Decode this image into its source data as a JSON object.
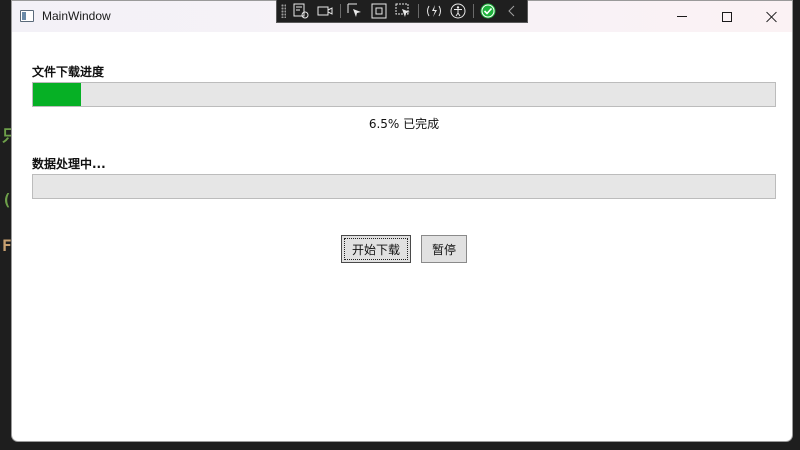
{
  "background": {
    "glyphs": [
      {
        "text": "只",
        "color": "#6ea04a"
      },
      {
        "text": "(",
        "color": "#6ea04a"
      },
      {
        "text": "F",
        "color": "#c8a070"
      }
    ]
  },
  "window": {
    "title": "MainWindow",
    "icon": "window-app-icon",
    "caption_buttons": [
      "minimize-icon",
      "maximize-icon",
      "close-icon"
    ]
  },
  "debug_toolbar": {
    "icons": [
      "grip-icon",
      "live-visual-tree-icon",
      "camera-icon",
      "select-element-icon",
      "display-layout-adorners-icon",
      "track-focus-icon",
      "hot-reload-icon",
      "accessibility-icon",
      "check-icon",
      "collapse-chevron-icon"
    ],
    "colors": {
      "check": "#1db33b",
      "icon": "#e8e8e8"
    }
  },
  "download": {
    "label": "文件下载进度",
    "progress": 0.065,
    "percent_text": "6.5% 已完成"
  },
  "processing": {
    "label": "数据处理中...",
    "progress": 0
  },
  "buttons": {
    "start": "开始下载",
    "pause": "暂停"
  },
  "colors": {
    "progress_fill": "#06b025",
    "progress_track": "#e6e6e6",
    "button_bg": "#e1e1e1"
  }
}
